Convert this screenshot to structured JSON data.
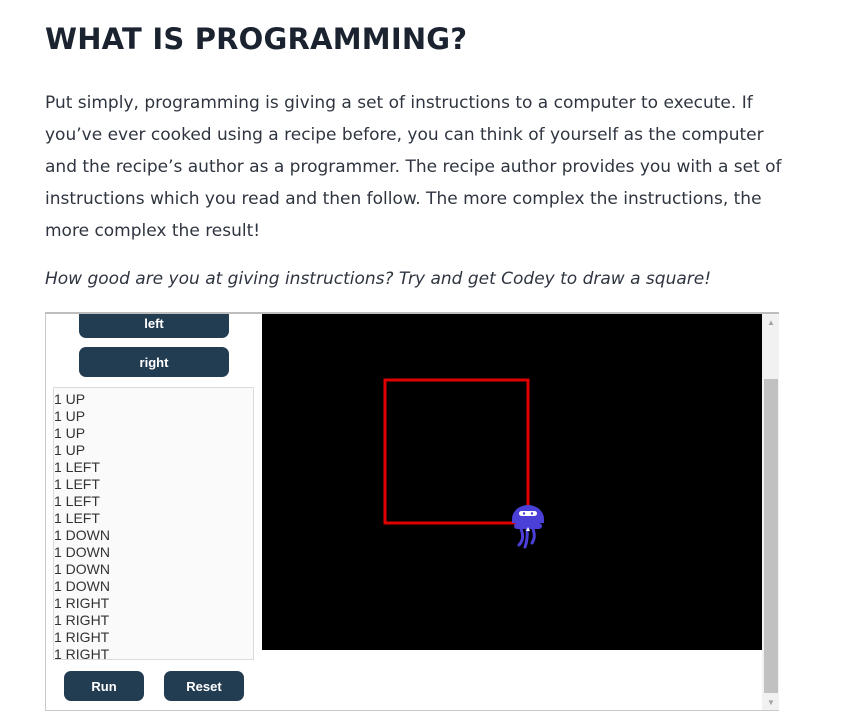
{
  "heading": "WHAT IS PROGRAMMING?",
  "paragraph": "Put simply, programming is giving a set of instructions to a computer to execute. If you’ve ever cooked using a recipe before, you can think of yourself as the computer and the recipe’s author as a programmer. The recipe author provides you with a set of instructions which you read and then follow. The more complex the instructions, the more complex the result!",
  "question": "How good are you at giving instructions? Try and get Codey to draw a square!",
  "controls": {
    "left_label": "left",
    "right_label": "right",
    "run_label": "Run",
    "reset_label": "Reset"
  },
  "instructions": [
    "1 UP",
    "1 UP",
    "1 UP",
    "1 UP",
    "1 LEFT",
    "1 LEFT",
    "1 LEFT",
    "1 LEFT",
    "1 DOWN",
    "1 DOWN",
    "1 DOWN",
    "1 DOWN",
    "1 RIGHT",
    "1 RIGHT",
    "1 RIGHT",
    "1 RIGHT"
  ],
  "colors": {
    "button": "#223c52",
    "canvas": "#000000",
    "path": "#e00000",
    "robot": "#4a3fd6"
  },
  "icons": {
    "robot": "codey-robot-icon",
    "scroll_up": "scroll-up-arrow",
    "scroll_down": "scroll-down-arrow"
  }
}
